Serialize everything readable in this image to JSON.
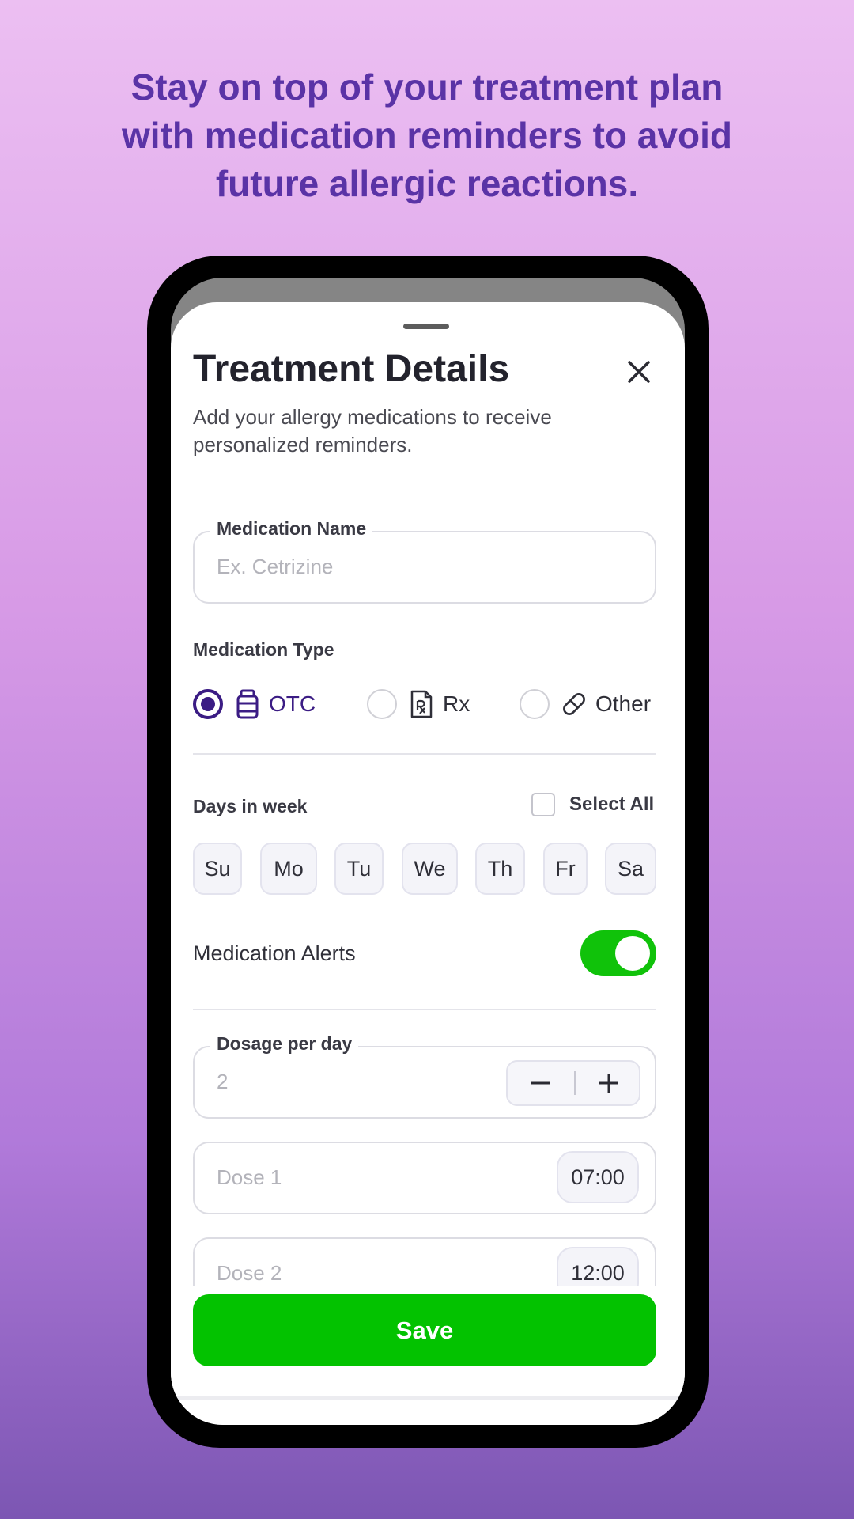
{
  "promo": {
    "headline_line1": "Stay on top of your treatment plan",
    "headline_line2": "with medication reminders to avoid",
    "headline_line3": "future allergic reactions."
  },
  "sheet": {
    "title": "Treatment Details",
    "subtitle": "Add your allergy medications to receive personalized reminders."
  },
  "medication_name": {
    "label": "Medication Name",
    "placeholder": "Ex. Cetrizine",
    "value": ""
  },
  "medication_type": {
    "label": "Medication Type",
    "selected": "OTC",
    "options": [
      {
        "label": "OTC",
        "icon": "pill-bottle-icon"
      },
      {
        "label": "Rx",
        "icon": "prescription-icon"
      },
      {
        "label": "Other",
        "icon": "pill-capsule-icon"
      }
    ]
  },
  "days": {
    "label": "Days in week",
    "select_all_label": "Select All",
    "select_all_checked": false,
    "items": [
      "Su",
      "Mo",
      "Tu",
      "We",
      "Th",
      "Fr",
      "Sa"
    ]
  },
  "alerts": {
    "label": "Medication Alerts",
    "enabled": true
  },
  "dosage": {
    "label": "Dosage per day",
    "value": "2",
    "decrement_icon": "minus-icon",
    "increment_icon": "plus-icon"
  },
  "doses": [
    {
      "label": "Dose 1",
      "time": "07:00"
    },
    {
      "label": "Dose 2",
      "time": "12:00"
    }
  ],
  "actions": {
    "save_label": "Save"
  },
  "colors": {
    "accent_purple": "#3b1c84",
    "headline_purple": "#5a33a6",
    "save_green": "#03c200",
    "toggle_green": "#10c20a"
  }
}
